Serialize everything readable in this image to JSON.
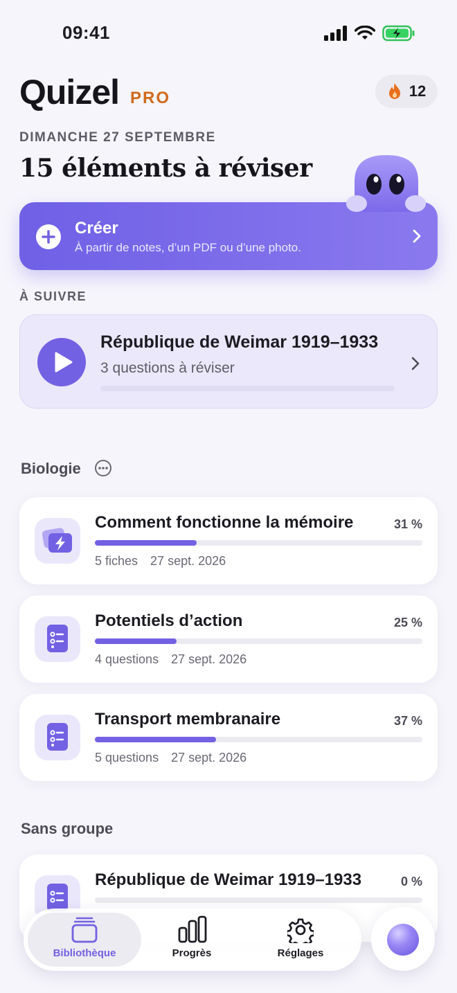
{
  "status_bar": {
    "time": "09:41"
  },
  "header": {
    "app_name": "Quizel",
    "badge": "PRO",
    "streak_count": "12",
    "date": "DIMANCHE 27 SEPTEMBRE",
    "review_count_title": "15 éléments à réviser"
  },
  "create": {
    "title": "Créer",
    "subtitle": "À partir de notes, d’un PDF ou d’une photo."
  },
  "follow": {
    "section_label": "À SUIVRE",
    "title": "République de Weimar 1919–1933",
    "subtitle": "3 questions à réviser",
    "progress": 0
  },
  "groups": [
    {
      "name": "Biologie",
      "items": [
        {
          "title": "Comment fonctionne la mémoire",
          "percent": "31 %",
          "progress": 0.31,
          "count": "5 fiches",
          "date": "27 sept. 2026",
          "icon": "flashcards-icon"
        },
        {
          "title": "Potentiels d’action",
          "percent": "25 %",
          "progress": 0.25,
          "count": "4 questions",
          "date": "27 sept. 2026",
          "icon": "quiz-list-icon"
        },
        {
          "title": "Transport membranaire",
          "percent": "37 %",
          "progress": 0.37,
          "count": "5 questions",
          "date": "27 sept. 2026",
          "icon": "quiz-list-icon"
        }
      ]
    },
    {
      "name": "Sans groupe",
      "items": [
        {
          "title": "République de Weimar 1919–1933",
          "percent": "0 %",
          "progress": 0,
          "icon": "quiz-list-icon"
        }
      ]
    }
  ],
  "tabs": [
    {
      "label": "Bibliothèque",
      "icon": "library-icon",
      "active": true
    },
    {
      "label": "Progrès",
      "icon": "bar-chart-icon",
      "active": false
    },
    {
      "label": "Réglages",
      "icon": "gear-icon",
      "active": false
    }
  ],
  "colors": {
    "accent": "#7361e3",
    "pro": "#d06a1e",
    "background": "#f6f5fb"
  }
}
